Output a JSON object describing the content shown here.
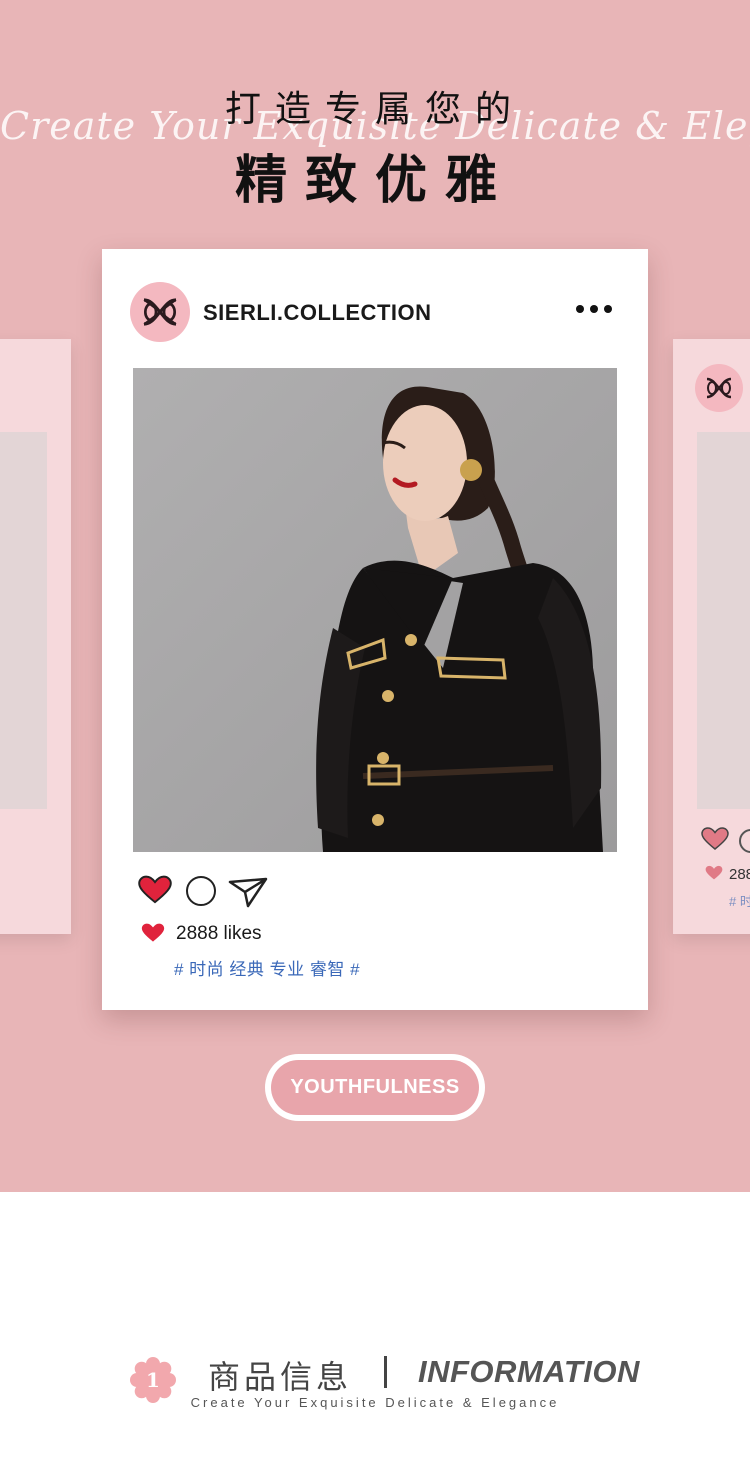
{
  "hero": {
    "script_text": "Create Your Exquisite Delicate & Elegance",
    "title_line1": "打造专属您的",
    "title_line2": "精致优雅",
    "background_color": "#e8b5b7"
  },
  "post": {
    "account_name": "SIERLI.COLLECTION",
    "more_icon": "more-horizontal-icon",
    "likes_text": "2888 likes",
    "hashtags": "# 时尚 经典 专业 睿智 #",
    "heart_color": "#e0233c",
    "hashtag_color": "#3a68b8"
  },
  "side_right": {
    "likes_partial": "288",
    "tag_partial": "# 时"
  },
  "badge": {
    "label": "YOUTHFULNESS"
  },
  "info": {
    "number": "1",
    "title_cn": "商品信息",
    "title_en": "INFORMATION",
    "subtitle": "Create Your Exquisite Delicate & Elegance"
  }
}
